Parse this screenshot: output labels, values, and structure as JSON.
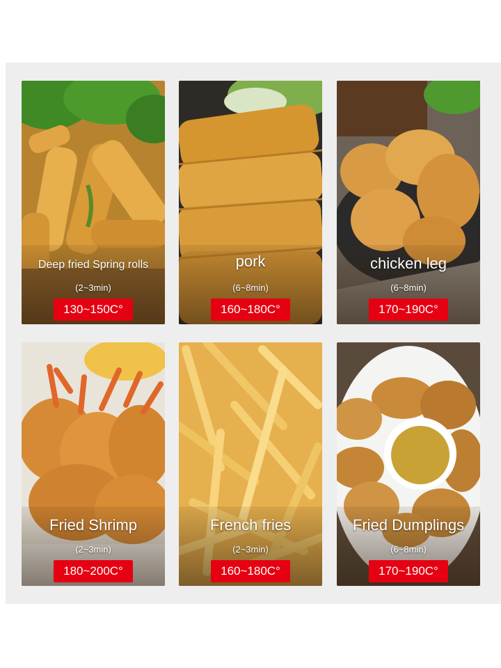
{
  "items": [
    {
      "name": "Deep fried Spring rolls",
      "time": "(2~3min)",
      "temp": "130~150C°"
    },
    {
      "name": "pork",
      "time": "(6~8min)",
      "temp": "160~180C°"
    },
    {
      "name": "chicken leg",
      "time": "(6~8min)",
      "temp": "170~190C°"
    },
    {
      "name": "Fried Shrimp",
      "time": "(2~3min)",
      "temp": "180~200C°"
    },
    {
      "name": "French fries",
      "time": "(2~3min)",
      "temp": "160~180C°"
    },
    {
      "name": "Fried Dumplings",
      "time": "(6~8min)",
      "temp": "170~190C°"
    }
  ],
  "colors": {
    "badge": "#e50012",
    "panel": "#eeeeee"
  }
}
